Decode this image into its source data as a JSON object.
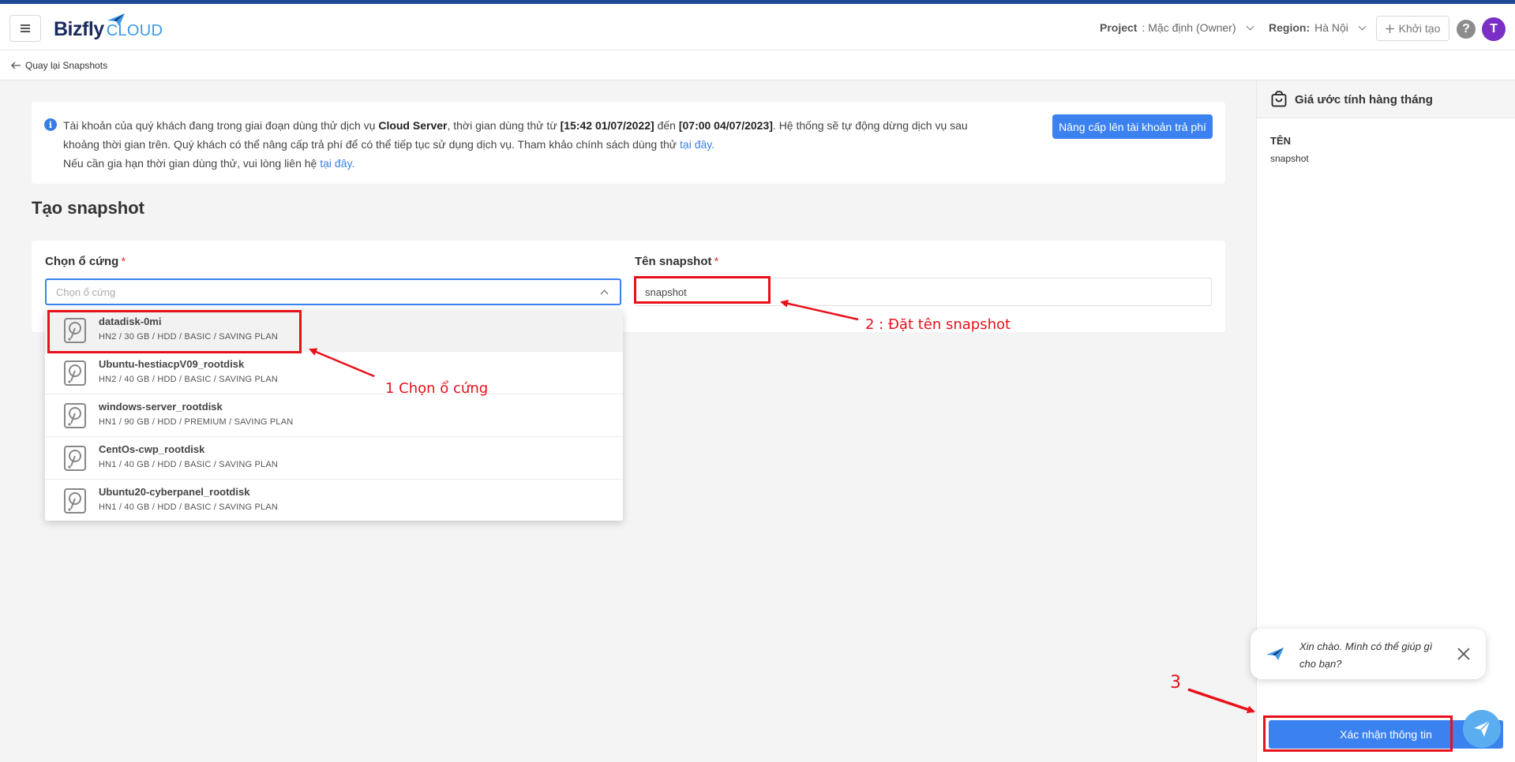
{
  "header": {
    "brand_left": "Bizfly",
    "brand_right": "CLOUD",
    "project_label": "Project",
    "project_value": ": Mặc định (Owner)",
    "region_label": "Region:",
    "region_value": "Hà Nội",
    "create_label": "Khởi tạo",
    "help_glyph": "?",
    "avatar_initial": "T"
  },
  "subbar": {
    "back_label": "Quay lại Snapshots"
  },
  "notice": {
    "line1_a": "Tài khoản của quý khách đang trong giai đoạn dùng thử dịch vụ ",
    "service": "Cloud Server",
    "line1_b": ", thời gian dùng thử từ ",
    "start": "[15:42 01/07/2022]",
    "line1_c": " đến ",
    "end": "[07:00 04/07/2023]",
    "line1_d": ". Hệ thống sẽ tự động dừng dịch vụ sau khoảng thời gian trên. Quý khách có thể nâng cấp trả phí để có thể tiếp tục sử dụng dịch vụ. Tham khảo chính sách dùng thử ",
    "link1": "tại đây.",
    "line2": "Nếu cần gia hạn thời gian dùng thử, vui lòng liên hệ ",
    "link2": "tại đây.",
    "upgrade_button": "Nâng cấp lên tài khoản trả phí"
  },
  "page_title": "Tạo snapshot",
  "form": {
    "disk_label": "Chọn ổ cứng",
    "disk_placeholder": "Chọn ổ cứng",
    "name_label": "Tên snapshot",
    "name_value": "snapshot",
    "required_mark": "*"
  },
  "disks": [
    {
      "name": "datadisk-0mi",
      "desc": "HN2 / 30 GB / HDD / BASIC / SAVING PLAN"
    },
    {
      "name": "Ubuntu-hestiacpV09_rootdisk",
      "desc": "HN2 / 40 GB / HDD / BASIC / SAVING PLAN"
    },
    {
      "name": "windows-server_rootdisk",
      "desc": "HN1 / 90 GB / HDD / PREMIUM / SAVING PLAN"
    },
    {
      "name": "CentOs-cwp_rootdisk",
      "desc": "HN1 / 40 GB / HDD / BASIC / SAVING PLAN"
    },
    {
      "name": "Ubuntu20-cyberpanel_rootdisk",
      "desc": "HN1 / 40 GB / HDD / BASIC / SAVING PLAN"
    }
  ],
  "sidepanel": {
    "title": "Giá ước tính hàng tháng",
    "column": "TÊN",
    "value": "snapshot"
  },
  "chat": {
    "message": "Xin chào. Mình có thể giúp gì cho bạn?"
  },
  "confirm_button": "Xác nhận thông tin",
  "annotations": {
    "step1": "1 Chọn ổ cứng",
    "step2": "2 : Đặt tên snapshot",
    "step3": "3"
  },
  "colors": {
    "primary": "#3b82f0",
    "annotation": "#e8101a",
    "brand_dark": "#1b2a5e",
    "brand_light": "#3b9ae8",
    "avatar": "#7b2fc6"
  }
}
